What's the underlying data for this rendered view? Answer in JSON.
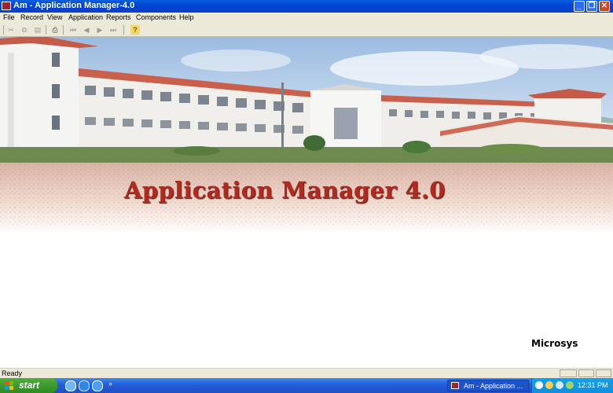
{
  "window": {
    "title": "Am - Application Manager-4.0",
    "buttons": {
      "minimize": "_",
      "maximize": "❐",
      "close": "✕"
    }
  },
  "menu": [
    "File",
    "Record",
    "View",
    "Application",
    "Reports",
    "Components",
    "Help"
  ],
  "toolbar": {
    "icons": [
      "cut-icon",
      "copy-icon",
      "paste-icon",
      "print-icon",
      "first-record-icon",
      "previous-record-icon",
      "next-record-icon",
      "last-record-icon",
      "help-icon"
    ],
    "glyphs": {
      "cut": "✂",
      "copy": "⧉",
      "paste": "▤",
      "print": "⎙",
      "first": "⏮",
      "prev": "◀",
      "next": "▶",
      "last": "⏭",
      "help": "?"
    }
  },
  "main": {
    "heading": "Application Manager 4.0",
    "brand": "Microsys"
  },
  "status": {
    "text": "Ready"
  },
  "taskbar": {
    "start_label": "start",
    "quicklaunch_more": "»",
    "task_label": "Am - Application ...",
    "clock": "12:31 PM"
  },
  "colors": {
    "heading": "#b22a1f",
    "titlebar": "#0046d5",
    "start": "#3c9a2e",
    "taskbar": "#245edb"
  }
}
